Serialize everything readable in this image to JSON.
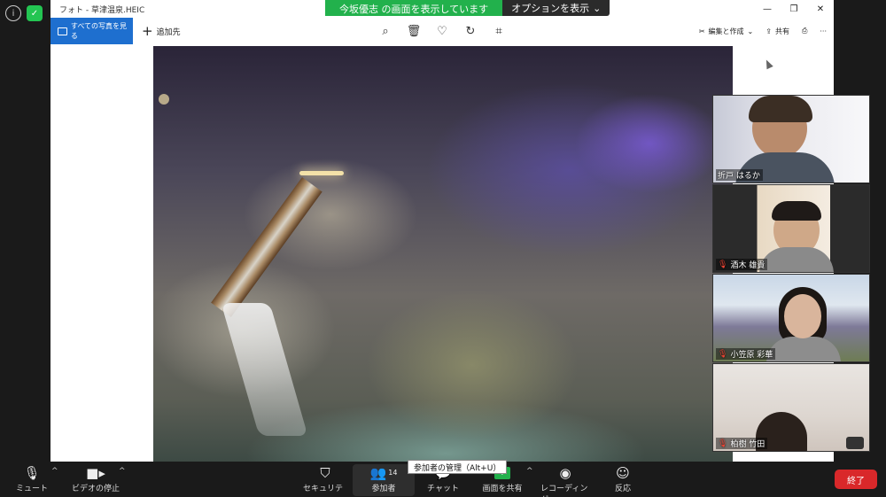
{
  "window": {
    "title": "フォト - 草津温泉.HEIC",
    "minimize": "—",
    "maximize": "❐",
    "close": "✕"
  },
  "share_banner": {
    "status": "今坂優志 の画面を表示しています",
    "options": "オプションを表示"
  },
  "toolbar": {
    "see_all": "すべての写真を見る",
    "add_to": "追加先",
    "edit_create": "編集と作成",
    "share": "共有"
  },
  "participants": [
    {
      "name": "折戸 はるか",
      "muted": false
    },
    {
      "name": "酒木 雄貴",
      "muted": true
    },
    {
      "name": "小笠原 彩華",
      "muted": true
    },
    {
      "name": "柏樹 竹田",
      "muted": true
    }
  ],
  "bottom_bar": {
    "mute": "ミュート",
    "stop_video": "ビデオの停止",
    "security": "セキュリティ",
    "participants": "参加者",
    "participant_count": "14",
    "chat": "チャット",
    "share_screen": "画面を共有",
    "recording": "レコーディング",
    "reactions": "反応",
    "end": "終了"
  },
  "tooltip": "参加者の管理（Alt+U）"
}
